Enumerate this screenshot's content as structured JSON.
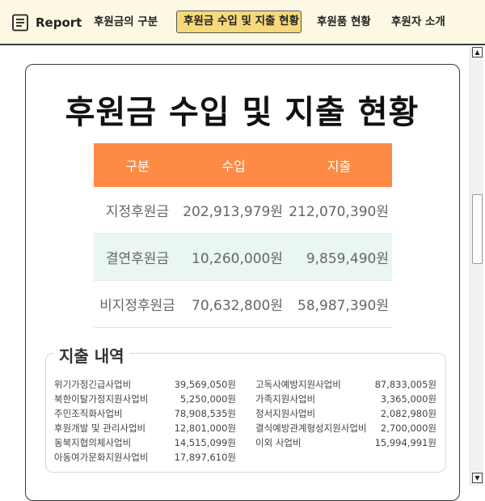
{
  "nav": {
    "brand": "Report",
    "items": [
      {
        "label": "후원금의 구분"
      },
      {
        "label": "후원금 수입 및 지출 현황"
      },
      {
        "label": "후원품 현황"
      },
      {
        "label": "후원자 소개"
      }
    ],
    "active_index": 1
  },
  "page": {
    "title": "후원금 수입 및 지출  현황"
  },
  "summary": {
    "headers": [
      "구분",
      "수입",
      "지출"
    ],
    "rows": [
      {
        "category": "지정후원금",
        "income": "202,913,979원",
        "expense": "212,070,390원"
      },
      {
        "category": "결연후원금",
        "income": "10,260,000원",
        "expense": "9,859,490원"
      },
      {
        "category": "비지정후원금",
        "income": "70,632,800원",
        "expense": "58,987,390원"
      }
    ]
  },
  "details": {
    "heading": "지출 내역",
    "left": [
      {
        "label": "위기가정긴급사업비",
        "amount": "39,569,050원"
      },
      {
        "label": "북한이탈가정지원사업비",
        "amount": "5,250,000원"
      },
      {
        "label": "주민조직화사업비",
        "amount": "78,908,535원"
      },
      {
        "label": "후원개발 및 관리사업비",
        "amount": "12,801,000원"
      },
      {
        "label": "동북지협의체사업비",
        "amount": "14,515,099원"
      },
      {
        "label": "아동여가문화지원사업비",
        "amount": "17,897,610원"
      }
    ],
    "right": [
      {
        "label": "고독사예방지원사업비",
        "amount": "87,833,005원"
      },
      {
        "label": "가족지원사업비",
        "amount": "3,365,000원"
      },
      {
        "label": "정서지원사업비",
        "amount": "2,082,980원"
      },
      {
        "label": "결식예방관계형성지원사업비",
        "amount": "2,700,000원"
      },
      {
        "label": "이외 사업비",
        "amount": "15,994,991원"
      }
    ]
  },
  "colors": {
    "header_orange": "#fd8b45",
    "nav_bg": "#fdf8e4",
    "nav_active": "#f7d97a",
    "alt_row": "#eaf6f3"
  },
  "icons": {
    "brand": "document-list-icon",
    "scroll_up": "triangle-up-icon",
    "scroll_down": "triangle-down-icon"
  }
}
